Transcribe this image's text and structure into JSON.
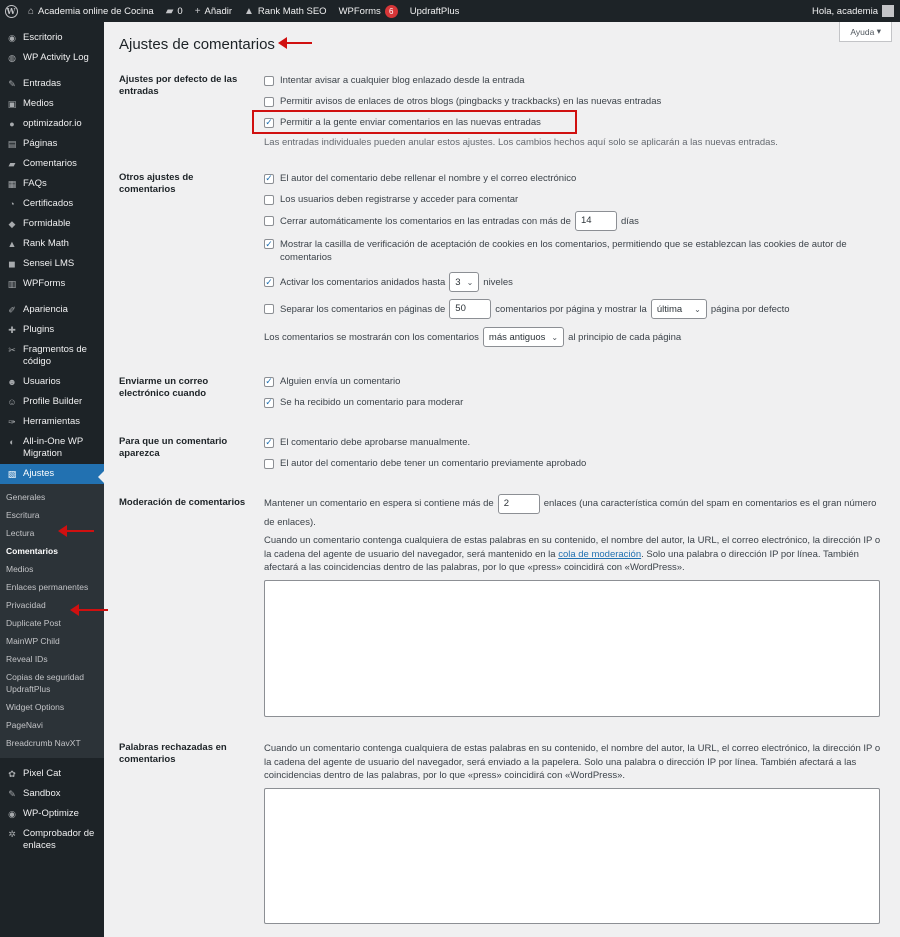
{
  "adminbar": {
    "site_name": "Academia online de Cocina",
    "comments_count": "0",
    "add_new": "Añadir",
    "rank_math": "Rank Math SEO",
    "wpforms": "WPForms",
    "wpforms_badge": "6",
    "updraft": "UpdraftPlus",
    "greeting": "Hola, academia"
  },
  "help_tab": "Ayuda",
  "sidebar": {
    "items": [
      {
        "label": "Escritorio",
        "icon": "dashboard-icon"
      },
      {
        "label": "WP Activity Log",
        "icon": "activity-log-icon"
      },
      {
        "label": "Entradas",
        "icon": "pin-icon"
      },
      {
        "label": "Medios",
        "icon": "media-icon"
      },
      {
        "label": "optimizador.io",
        "icon": "optimizer-icon"
      },
      {
        "label": "Páginas",
        "icon": "pages-icon"
      },
      {
        "label": "Comentarios",
        "icon": "comments-icon"
      },
      {
        "label": "FAQs",
        "icon": "faq-icon"
      },
      {
        "label": "Certificados",
        "icon": "certificate-icon"
      },
      {
        "label": "Formidable",
        "icon": "formidable-icon"
      },
      {
        "label": "Rank Math",
        "icon": "rank-math-icon"
      },
      {
        "label": "Sensei LMS",
        "icon": "sensei-icon"
      },
      {
        "label": "WPForms",
        "icon": "wpforms-icon"
      },
      {
        "label": "Apariencia",
        "icon": "appearance-icon"
      },
      {
        "label": "Plugins",
        "icon": "plugins-icon"
      },
      {
        "label": "Fragmentos de código",
        "icon": "snippets-icon"
      },
      {
        "label": "Usuarios",
        "icon": "users-icon"
      },
      {
        "label": "Profile Builder",
        "icon": "profile-icon"
      },
      {
        "label": "Herramientas",
        "icon": "tools-icon"
      },
      {
        "label": "All-in-One WP Migration",
        "icon": "migration-icon"
      },
      {
        "label": "Ajustes",
        "icon": "settings-icon"
      }
    ],
    "submenu": [
      "Generales",
      "Escritura",
      "Lectura",
      "Comentarios",
      "Medios",
      "Enlaces permanentes",
      "Privacidad",
      "Duplicate Post",
      "MainWP Child",
      "Reveal IDs",
      "Copias de seguridad UpdraftPlus",
      "Widget Options",
      "PageNavi",
      "Breadcrumb NavXT"
    ],
    "after": [
      {
        "label": "Pixel Cat",
        "icon": "cat-icon"
      },
      {
        "label": "Sandbox",
        "icon": "sandbox-icon"
      },
      {
        "label": "WP-Optimize",
        "icon": "optimize-icon"
      },
      {
        "label": "Comprobador de enlaces",
        "icon": "link-checker-icon"
      }
    ]
  },
  "page": {
    "title": "Ajustes de comentarios",
    "default_post": {
      "label": "Ajustes por defecto de las entradas",
      "opt1": "Intentar avisar a cualquier blog enlazado desde la entrada",
      "opt2": "Permitir avisos de enlaces de otros blogs (pingbacks y trackbacks) en las nuevas entradas",
      "opt3": "Permitir a la gente enviar comentarios en las nuevas entradas",
      "note": "Las entradas individuales pueden anular estos ajustes. Los cambios hechos aquí solo se aplicarán a las nuevas entradas."
    },
    "other": {
      "label": "Otros ajustes de comentarios",
      "opt1": "El autor del comentario debe rellenar el nombre y el correo electrónico",
      "opt2": "Los usuarios deben registrarse y acceder para comentar",
      "opt3_before": "Cerrar automáticamente los comentarios en las entradas con más de",
      "opt3_value": "14",
      "opt3_after": "días",
      "opt4": "Mostrar la casilla de verificación de aceptación de cookies en los comentarios, permitiendo que se establezcan las cookies de autor de comentarios",
      "opt5_before": "Activar los comentarios anidados hasta",
      "opt5_value": "3",
      "opt5_after": "niveles",
      "opt6_before": "Separar los comentarios en páginas de",
      "opt6_value": "50",
      "opt6_mid": "comentarios por página y mostrar la",
      "opt6_select": "última",
      "opt6_after": "página por defecto",
      "order_before": "Los comentarios se mostrarán con los comentarios",
      "order_select": "más antiguos",
      "order_after": "al principio de cada página"
    },
    "email": {
      "label": "Enviarme un correo electrónico cuando",
      "opt1": "Alguien envía un comentario",
      "opt2": "Se ha recibido un comentario para moderar"
    },
    "appear": {
      "label": "Para que un comentario aparezca",
      "opt1": "El comentario debe aprobarse manualmente.",
      "opt2": "El autor del comentario debe tener un comentario previamente aprobado"
    },
    "moderation": {
      "label": "Moderación de comentarios",
      "line_before": "Mantener un comentario en espera si contiene más de",
      "line_value": "2",
      "line_after": "enlaces (una característica común del spam en comentarios es el gran número de enlaces).",
      "desc_before": "Cuando un comentario contenga cualquiera de estas palabras en su contenido, el nombre del autor, la URL, el correo electrónico, la dirección IP o la cadena del agente de usuario del navegador, será mantenido en la",
      "desc_link": "cola de moderación",
      "desc_after": ". Solo una palabra o dirección IP por línea. También afectará a las coincidencias dentro de las palabras, por lo que «press» coincidirá con «WordPress»."
    },
    "blocked": {
      "label": "Palabras rechazadas en comentarios",
      "desc": "Cuando un comentario contenga cualquiera de estas palabras en su contenido, el nombre del autor, la URL, el correo electrónico, la dirección IP o la cadena del agente de usuario del navegador, será enviado a la papelera. Solo una palabra o dirección IP por línea. También afectará a las coincidencias dentro de las palabras, por lo que «press» coincidirá con «WordPress»."
    }
  }
}
